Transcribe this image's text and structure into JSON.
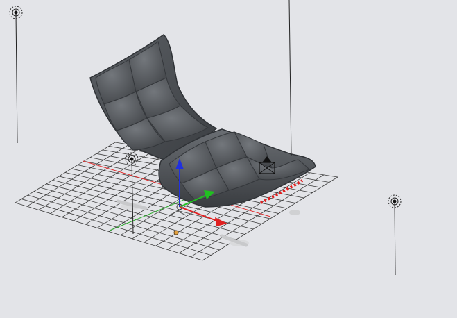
{
  "viewport": {
    "background": "#e3e4e8",
    "grid_color": "#3c3c3c",
    "x_axis_color": "#e03030",
    "y_axis_color": "#30b030",
    "chair_color": "#505458",
    "chair_highlight": "#6c7075",
    "chair_shadow": "#2f3236"
  },
  "gizmo": {
    "x_axis_color": "#e02020",
    "y_axis_color": "#20c020",
    "z_axis_color": "#2030e0"
  },
  "lights": [
    {
      "name": "lamp-top-left"
    },
    {
      "name": "lamp-left-center"
    },
    {
      "name": "lamp-right"
    }
  ],
  "camera": {
    "icon": "camera-icon"
  },
  "origin_marker_color": "#e0a040"
}
